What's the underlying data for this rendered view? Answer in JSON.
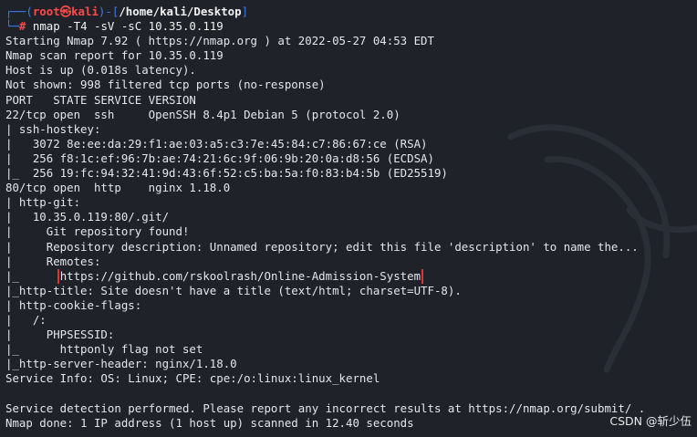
{
  "prompt": {
    "frame_left": "┌──(",
    "user": "root",
    "skull": "㉿",
    "host": "kali",
    "frame_mid": ")-[",
    "path": "/home/kali/Desktop",
    "frame_right": "]",
    "frame_bottom": "└─",
    "hash": "#",
    "command": "nmap -T4 -sV -sC 10.35.0.119"
  },
  "output_lines": [
    "Starting Nmap 7.92 ( https://nmap.org ) at 2022-05-27 04:53 EDT",
    "Nmap scan report for 10.35.0.119",
    "Host is up (0.018s latency).",
    "Not shown: 998 filtered tcp ports (no-response)",
    "PORT   STATE SERVICE VERSION",
    "22/tcp open  ssh     OpenSSH 8.4p1 Debian 5 (protocol 2.0)",
    "| ssh-hostkey:",
    "|   3072 8e:ee:da:29:f1:ae:03:a5:c3:7e:45:84:c7:86:67:ce (RSA)",
    "|   256 f8:1c:ef:96:7b:ae:74:21:6c:9f:06:9b:20:0a:d8:56 (ECDSA)",
    "|_  256 19:fc:94:32:41:9d:43:6f:52:c5:ba:5a:f0:83:b4:5b (ED25519)",
    "80/tcp open  http    nginx 1.18.0",
    "| http-git:",
    "|   10.35.0.119:80/.git/",
    "|     Git repository found!",
    "|     Repository description: Unnamed repository; edit this file 'description' to name the...",
    "|     Remotes:"
  ],
  "highlight": {
    "prefix": "|_      ",
    "url": "https://github.com/rskoolrash/Online-Admission-System"
  },
  "output_lines_2": [
    "|_http-title: Site doesn't have a title (text/html; charset=UTF-8).",
    "| http-cookie-flags:",
    "|   /:",
    "|     PHPSESSID:",
    "|_      httponly flag not set",
    "|_http-server-header: nginx/1.18.0",
    "Service Info: OS: Linux; CPE: cpe:/o:linux:linux_kernel",
    "",
    "Service detection performed. Please report any incorrect results at https://nmap.org/submit/ .",
    "Nmap done: 1 IP address (1 host up) scanned in 12.40 seconds"
  ],
  "watermark": "CSDN @斩少伍",
  "colors": {
    "background": "#1f2229",
    "prompt_frame": "#3b7bf0",
    "prompt_user": "#ff4a4a",
    "highlight_box": "#e03434",
    "text": "#e4e6ea"
  }
}
